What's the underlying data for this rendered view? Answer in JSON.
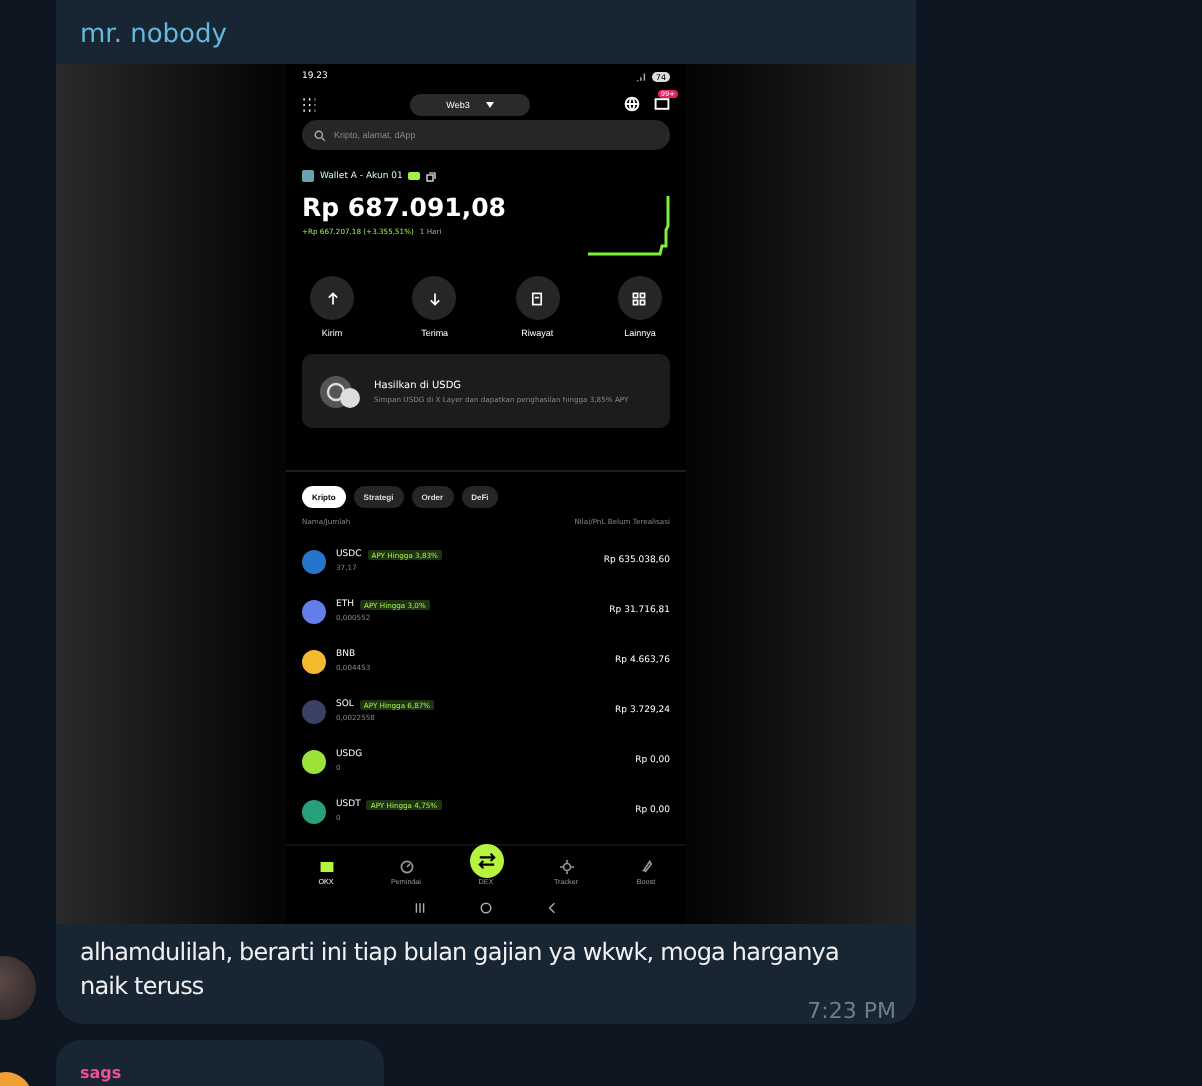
{
  "message": {
    "sender": "mr. nobody",
    "phone": {
      "status": {
        "time": "19.23",
        "battery": "74"
      },
      "network": "Web3",
      "notif_badge": "99+",
      "search": {
        "placeholder": "Kripto, alamat, dApp"
      },
      "wallet": "Wallet A - Akun 01",
      "balance": "Rp 687.091,08",
      "change": "+Rp 667.207,18 (+3.355,51%)",
      "period": "1 Hari",
      "actions": [
        {
          "kind": "send",
          "label": "Kirim"
        },
        {
          "kind": "receive",
          "label": "Terima"
        },
        {
          "kind": "history",
          "label": "Riwayat"
        },
        {
          "kind": "more",
          "label": "Lainnya"
        }
      ],
      "promo": {
        "title": "Hasilkan di USDG",
        "text": "Simpan USDG di X Layer dan dapatkan penghasilan hingga 3,85% APY"
      },
      "tabs": [
        {
          "label": "Kripto",
          "selected": true
        },
        {
          "label": "Strategi",
          "selected": false
        },
        {
          "label": "Order",
          "selected": false
        },
        {
          "label": "DeFi",
          "selected": false
        }
      ],
      "columns": [
        "Nama/Jumlah",
        "Nilai/PnL Belum Terealisasi"
      ],
      "tokens": [
        {
          "name": "USDC",
          "badge": "APY Hingga 3,83%",
          "amount": "37,17",
          "value": "Rp 635.038,60",
          "color": "#2775ca"
        },
        {
          "name": "ETH",
          "badge": "APY Hingga 3,0%",
          "amount": "0,000552",
          "value": "Rp 31.716,81",
          "color": "#627eea"
        },
        {
          "name": "BNB",
          "amount": "0,004453",
          "value": "Rp 4.663,76",
          "color": "#f3ba2f"
        },
        {
          "name": "SOL",
          "badge": "APY Hingga 6,87%",
          "amount": "0,0022558",
          "value": "Rp 3.729,24",
          "color": "#3a3f66"
        },
        {
          "name": "USDG",
          "amount": "0",
          "value": "Rp 0,00",
          "color": "#9be23a"
        },
        {
          "name": "USDT",
          "badge": "APY Hingga 4,75%",
          "amount": "0",
          "value": "Rp 0,00",
          "color": "#26a17b"
        }
      ],
      "nav": [
        {
          "kind": "wallet",
          "label": "OKX",
          "selected": true
        },
        {
          "kind": "scan",
          "label": "Pemindai",
          "selected": false
        },
        {
          "kind": "swap",
          "label": "DEX",
          "selected": false
        },
        {
          "kind": "tracker",
          "label": "Tracker",
          "selected": false
        },
        {
          "kind": "boost",
          "label": "Boost",
          "selected": false
        }
      ]
    },
    "text": "alhamdulilah, berarti ini tiap bulan gajian ya wkwk, moga harganya naik teruss",
    "time": "7:23 PM"
  },
  "next_message": {
    "sender": "sags"
  }
}
